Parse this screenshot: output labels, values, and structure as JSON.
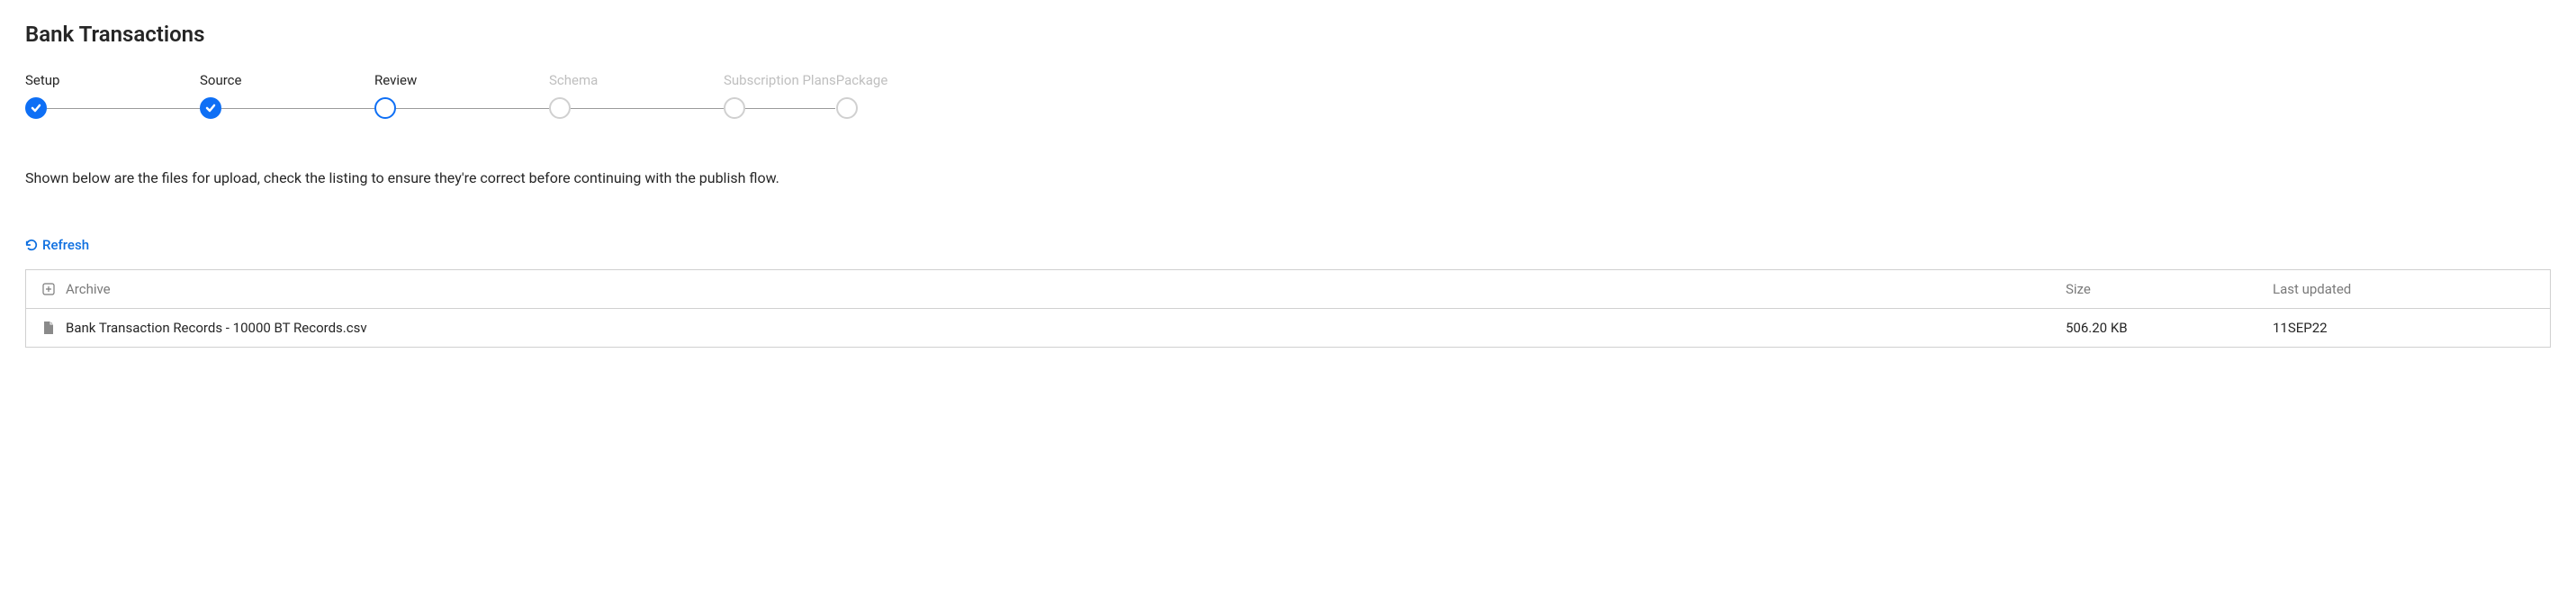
{
  "title": "Bank Transactions",
  "stepper": {
    "steps": [
      {
        "label": "Setup",
        "state": "done"
      },
      {
        "label": "Source",
        "state": "done"
      },
      {
        "label": "Review",
        "state": "current"
      },
      {
        "label": "Schema",
        "state": "pending"
      },
      {
        "label": "Subscription Plans",
        "state": "pending"
      },
      {
        "label": "Package",
        "state": "pending"
      }
    ]
  },
  "description": "Shown below are the files for upload, check the listing to ensure they're correct before continuing with the publish flow.",
  "refresh_label": "Refresh",
  "table": {
    "headers": {
      "archive": "Archive",
      "size": "Size",
      "updated": "Last updated"
    },
    "rows": [
      {
        "name": "Bank Transaction Records - 10000 BT Records.csv",
        "size": "506.20 KB",
        "updated": "11SEP22"
      }
    ]
  }
}
